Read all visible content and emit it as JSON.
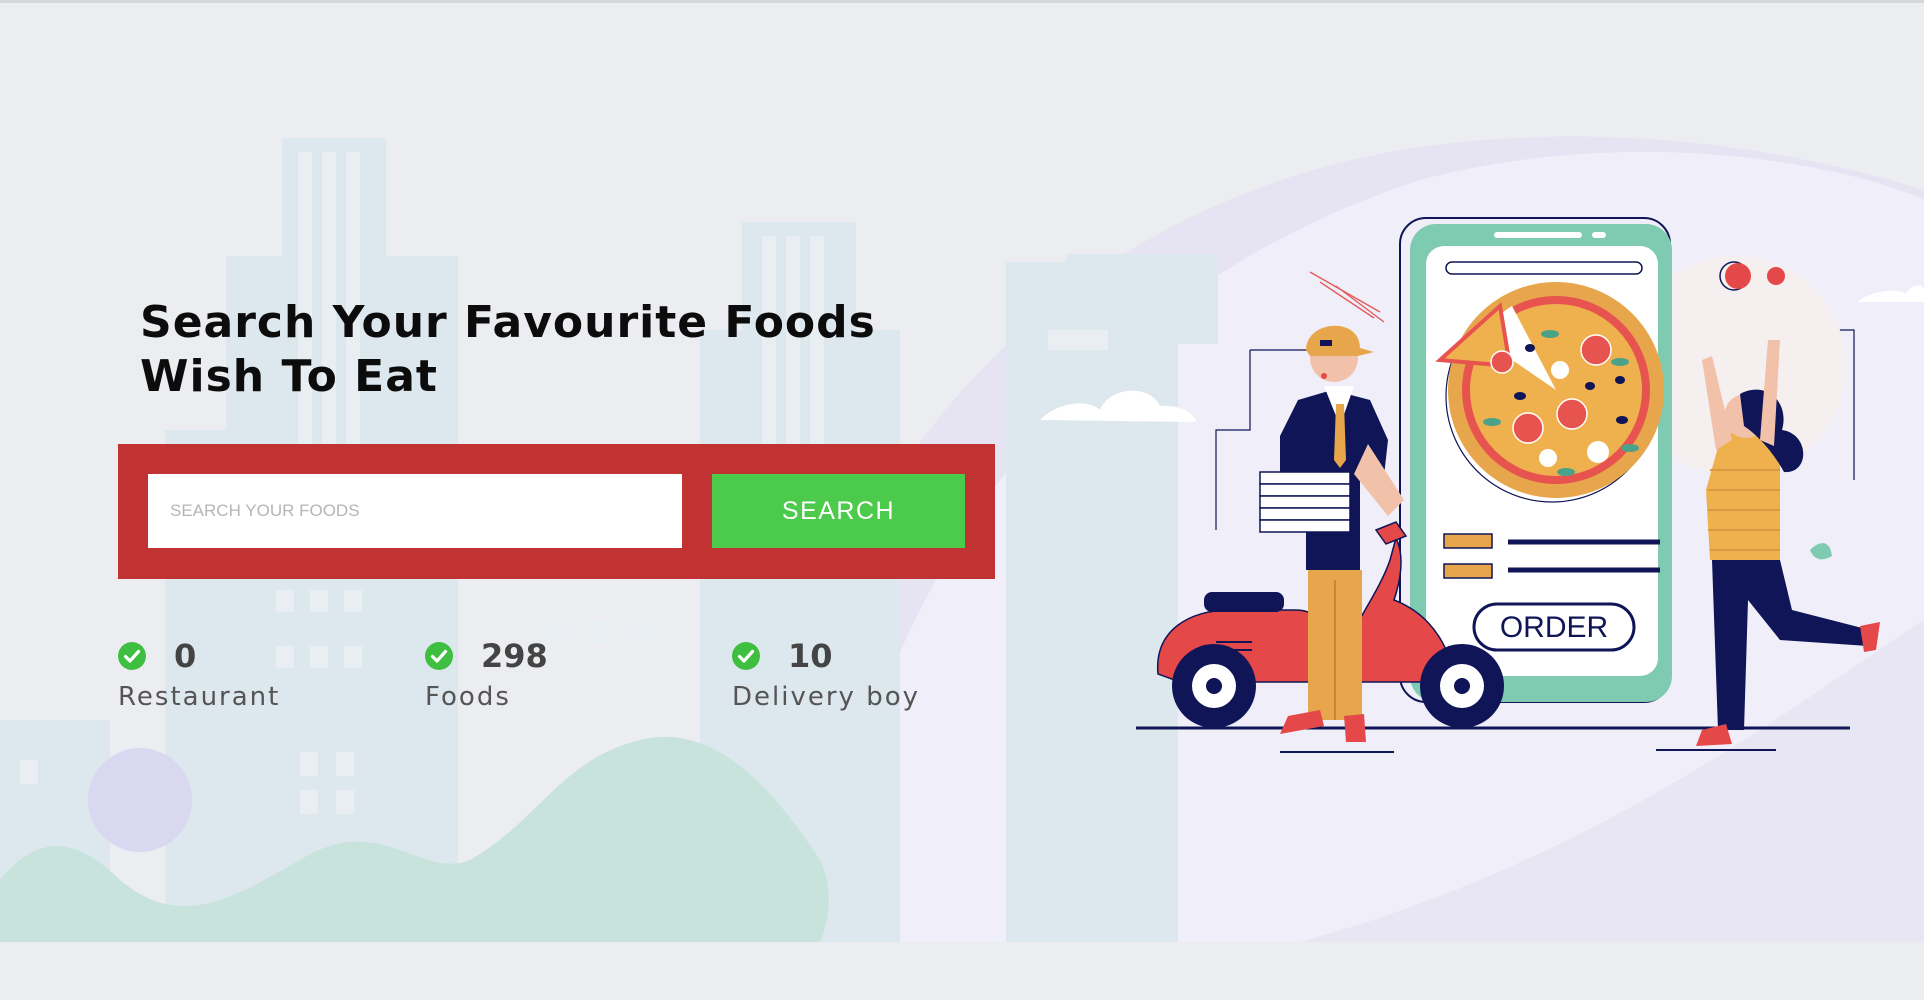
{
  "hero": {
    "headline_line1": "Search Your Favourite Foods",
    "headline_line2": "Wish To Eat"
  },
  "search": {
    "placeholder": "SEARCH YOUR FOODS",
    "value": "",
    "button_label": "SEARCH"
  },
  "stats": [
    {
      "count": "0",
      "label": "Restaurant"
    },
    {
      "count": "298",
      "label": "Foods"
    },
    {
      "count": "10",
      "label": "Delivery boy"
    }
  ],
  "illustration": {
    "order_label": "ORDER"
  },
  "colors": {
    "search_box_bg": "#c13232",
    "search_button_bg": "#4bca4b",
    "check_green": "#3fbf3f",
    "page_bg": "#ecedf1"
  }
}
